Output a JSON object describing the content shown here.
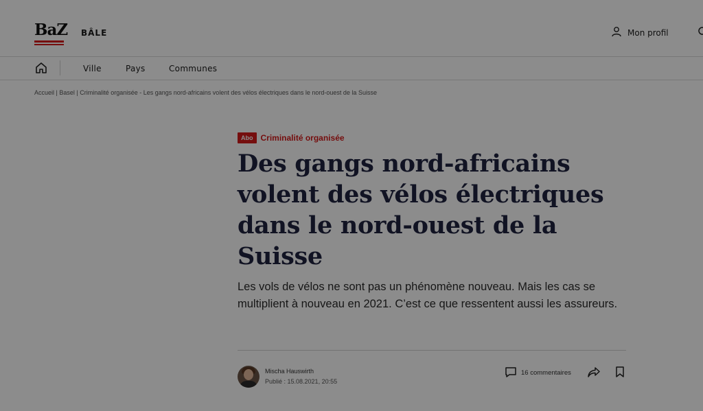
{
  "header": {
    "logo": "BaZ",
    "region": "BÂLE",
    "profile_label": "Mon profil",
    "icons": [
      "user-icon",
      "search-icon"
    ]
  },
  "nav": {
    "home_icon": "home-icon",
    "items": [
      {
        "label": "Ville"
      },
      {
        "label": "Pays"
      },
      {
        "label": "Communes"
      }
    ]
  },
  "breadcrumb": {
    "items": [
      "Accueil",
      "Basel",
      "Criminalité organisée - Les gangs nord-africains volent des vélos électriques dans le nord-ouest de la Suisse"
    ],
    "separator": " | "
  },
  "article": {
    "badge": "Abo",
    "topic": "Criminalité organisée",
    "title": "Des gangs nord-africains volent des vélos électriques dans le nord-ouest de la Suisse",
    "lead": "Les vols de vélos ne sont pas un phénomène nouveau. Mais les cas se multiplient à nouveau en 2021. C’est ce que ressentent aussi les assureurs.",
    "author": "Mischa Hauswirth",
    "published": "Publié : 15.08.2021, 20:55",
    "comments": "16 commentaires"
  },
  "colors": {
    "brand_red": "#d51a1a",
    "title_navy": "#1f2440",
    "overlay": "rgba(0,0,0,0.45)"
  }
}
